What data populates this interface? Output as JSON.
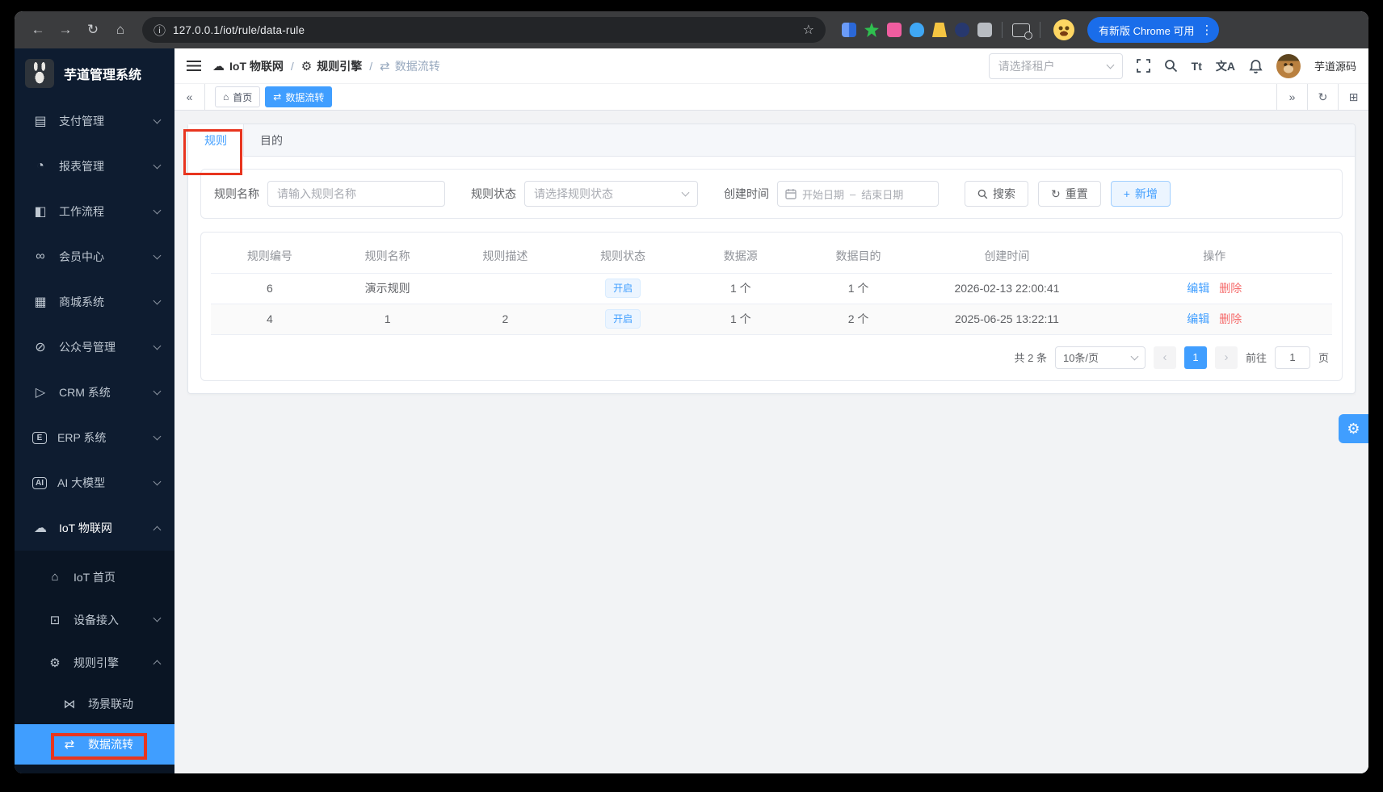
{
  "colors": {
    "accent": "#409eff",
    "danger": "#f56c6c",
    "sidebar_bg": "#0e1c30",
    "active_menu_bg": "#409eff",
    "tag_open_bg": "#ecf5ff",
    "chrome_pill_bg": "#1a6dea"
  },
  "browser": {
    "url": "127.0.0.1/iot/rule/data-rule",
    "update_label": "有新版 Chrome 可用"
  },
  "sidebar": {
    "title": "芋道管理系统",
    "items": [
      {
        "label": "支付管理"
      },
      {
        "label": "报表管理"
      },
      {
        "label": "工作流程"
      },
      {
        "label": "会员中心"
      },
      {
        "label": "商城系统"
      },
      {
        "label": "公众号管理"
      },
      {
        "label": "CRM 系统"
      },
      {
        "label": "ERP 系统"
      },
      {
        "label": "AI 大模型"
      },
      {
        "label": "IoT 物联网"
      }
    ],
    "submenu": [
      {
        "label": "IoT 首页"
      },
      {
        "label": "设备接入"
      },
      {
        "label": "规则引擎"
      }
    ],
    "deep": [
      {
        "label": "场景联动"
      },
      {
        "label": "数据流转"
      }
    ]
  },
  "header": {
    "breadcrumb": [
      {
        "label": "IoT 物联网"
      },
      {
        "label": "规则引擎"
      },
      {
        "label": "数据流转"
      }
    ],
    "separator": "/",
    "tenant_placeholder": "请选择租户",
    "username": "芋道源码"
  },
  "tags": {
    "home": "首页",
    "current": "数据流转"
  },
  "tabs": {
    "rule": "规则",
    "target": "目的"
  },
  "form": {
    "name_label": "规则名称",
    "name_placeholder": "请输入规则名称",
    "status_label": "规则状态",
    "status_placeholder": "请选择规则状态",
    "time_label": "创建时间",
    "start_placeholder": "开始日期",
    "end_placeholder": "结束日期",
    "search": "搜索",
    "reset": "重置",
    "add": "新增"
  },
  "table": {
    "columns": [
      "规则编号",
      "规则名称",
      "规则描述",
      "规则状态",
      "数据源",
      "数据目的",
      "创建时间",
      "操作"
    ],
    "rows": [
      {
        "id": "6",
        "name": "演示规则",
        "desc": "",
        "status": "开启",
        "source": "1 个",
        "dest": "1 个",
        "created": "2026-02-13 22:00:41"
      },
      {
        "id": "4",
        "name": "1",
        "desc": "2",
        "status": "开启",
        "source": "1 个",
        "dest": "2 个",
        "created": "2025-06-25 13:22:11"
      }
    ],
    "edit": "编辑",
    "delete": "删除"
  },
  "pagination": {
    "total": "共 2 条",
    "page_size": "10条/页",
    "prev": "‹",
    "page": "1",
    "next": "›",
    "goto": "前往",
    "goto_value": "1",
    "unit": "页"
  },
  "icons": {
    "back": "←",
    "forward": "→",
    "reload": "↻",
    "home": "⌂",
    "info": "ⓘ",
    "star": "☆",
    "kebab": "⋮",
    "payment": "▤",
    "report": "◔",
    "workflow": "◧",
    "member": "∞",
    "mall": "▦",
    "mp": "⊘",
    "crm": "▷",
    "erp": "E",
    "ai": "AI",
    "iot": "☁",
    "iot_home": "⌂",
    "device": "⊡",
    "rule_engine": "⚙",
    "scene": "⋈",
    "dataflow": "⇄",
    "collapse": "«",
    "expand": "»",
    "grid": "⊞",
    "font_size": "Tt",
    "translate": "文A",
    "plus": "+",
    "range_sep": "–",
    "gear": "⚙"
  }
}
